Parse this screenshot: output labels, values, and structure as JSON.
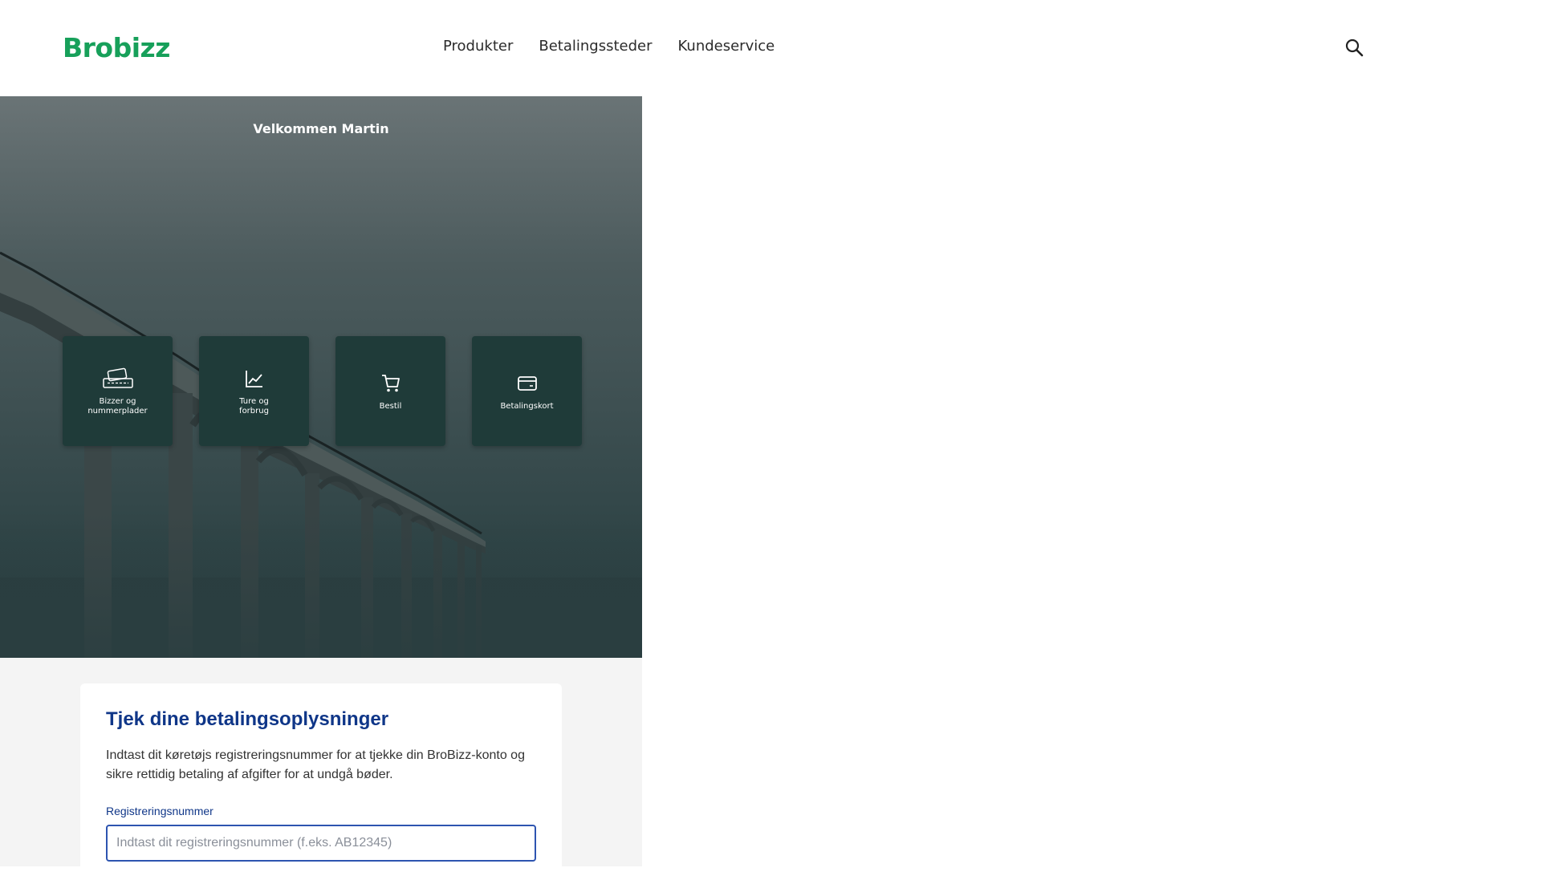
{
  "header": {
    "logo": "Brobizz",
    "nav": [
      "Produkter",
      "Betalingssteder",
      "Kundeservice"
    ],
    "search_icon": "search-icon"
  },
  "hero": {
    "title": "Velkommen Martin",
    "tiles": [
      {
        "label": "Bizzer og\nnummerplader",
        "icon": "bizz-plate-icon"
      },
      {
        "label": "Ture og\nforbrug",
        "icon": "chart-line-icon"
      },
      {
        "label": "Bestil",
        "icon": "cart-icon"
      },
      {
        "label": "Betalingskort",
        "icon": "credit-card-icon"
      }
    ]
  },
  "payment_check": {
    "title": "Tjek dine betalingsoplysninger",
    "description": "Indtast dit køretøjs registreringsnummer for at tjekke din BroBizz-konto og sikre rettidig betaling af afgifter for at undgå bøder.",
    "field_label": "Registreringsnummer",
    "field_placeholder": "Indtast dit registreringsnummer (f.eks. AB12345)",
    "field_value": ""
  },
  "colors": {
    "brand_green": "#17a05a",
    "tile_bg": "#1f3b39",
    "heading_blue": "#0f3688",
    "input_border": "#2d54b0"
  }
}
